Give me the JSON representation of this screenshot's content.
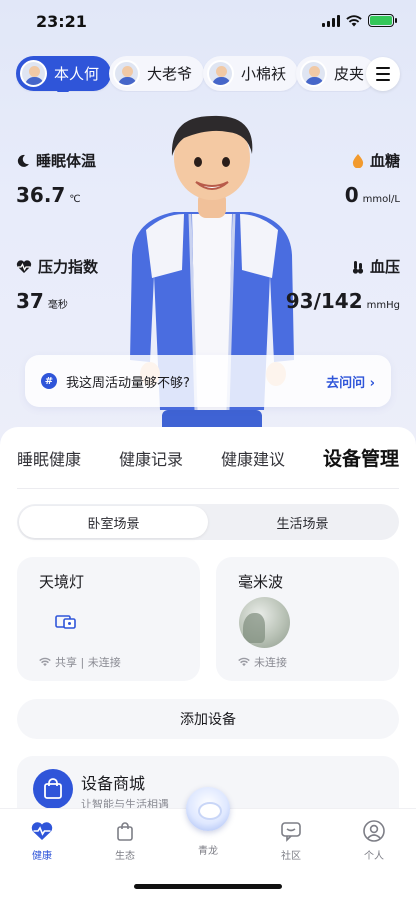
{
  "status_bar": {
    "time": "23:21"
  },
  "profiles": [
    {
      "name": "本人何",
      "active": true
    },
    {
      "name": "大老爷",
      "active": false
    },
    {
      "name": "小棉袄",
      "active": false
    },
    {
      "name": "皮夹",
      "active": false
    }
  ],
  "metrics": {
    "sleep_temp": {
      "label": "睡眠体温",
      "value": "36.7",
      "unit": "℃"
    },
    "blood_sugar": {
      "label": "血糖",
      "value": "0",
      "unit": "mmol/L"
    },
    "stress": {
      "label": "压力指数",
      "value": "37",
      "unit": "毫秒"
    },
    "blood_pressure": {
      "label": "血压",
      "value": "93/142",
      "unit": "mmHg"
    }
  },
  "ask": {
    "text": "我这周活动量够不够?",
    "link": "去问问 ›"
  },
  "tabs": [
    "睡眠健康",
    "健康记录",
    "健康建议",
    "设备管理"
  ],
  "active_tab": "设备管理",
  "scenes": [
    "卧室场景",
    "生活场景"
  ],
  "devices": [
    {
      "name": "天境灯",
      "status": "共享 | 未连接"
    },
    {
      "name": "毫米波",
      "status": "未连接"
    }
  ],
  "add_device": "添加设备",
  "shop": {
    "title": "设备商城",
    "subtitle": "让智能与生活相遇"
  },
  "nav": {
    "health": "健康",
    "ecology": "生态",
    "center": "青龙",
    "community": "社区",
    "personal": "个人"
  },
  "colors": {
    "accent": "#2f55d9",
    "blood_sugar_icon": "#f29a2e"
  }
}
